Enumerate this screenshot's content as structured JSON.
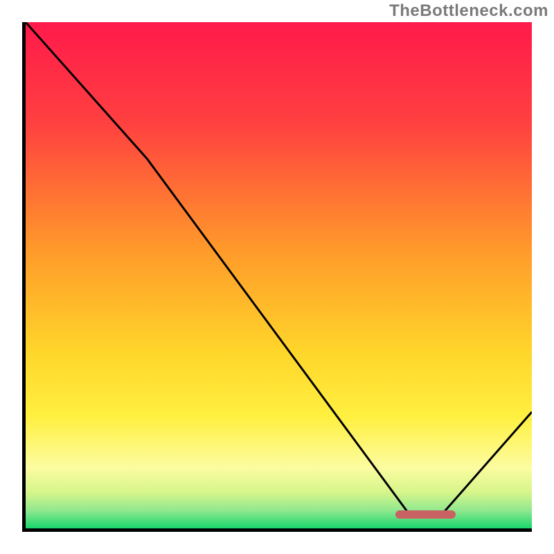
{
  "watermark": "TheBottleneck.com",
  "chart_data": {
    "type": "line",
    "title": "",
    "xlabel": "",
    "ylabel": "",
    "xlim": [
      0,
      100
    ],
    "ylim": [
      0,
      100
    ],
    "series": [
      {
        "name": "curve",
        "x": [
          0,
          24,
          76,
          82,
          100
        ],
        "y": [
          100,
          73,
          2.5,
          2.5,
          23
        ]
      }
    ],
    "optimal_marker": {
      "x_start": 73,
      "x_end": 85,
      "y": 2.7
    },
    "gradient_stops": [
      {
        "offset": 0,
        "color": "#ff1a4b"
      },
      {
        "offset": 0.2,
        "color": "#ff4040"
      },
      {
        "offset": 0.45,
        "color": "#ff9a2a"
      },
      {
        "offset": 0.65,
        "color": "#ffd52a"
      },
      {
        "offset": 0.78,
        "color": "#fff040"
      },
      {
        "offset": 0.88,
        "color": "#fcfca0"
      },
      {
        "offset": 0.93,
        "color": "#d5f58a"
      },
      {
        "offset": 0.965,
        "color": "#8fe88f"
      },
      {
        "offset": 1.0,
        "color": "#18d66c"
      }
    ]
  }
}
